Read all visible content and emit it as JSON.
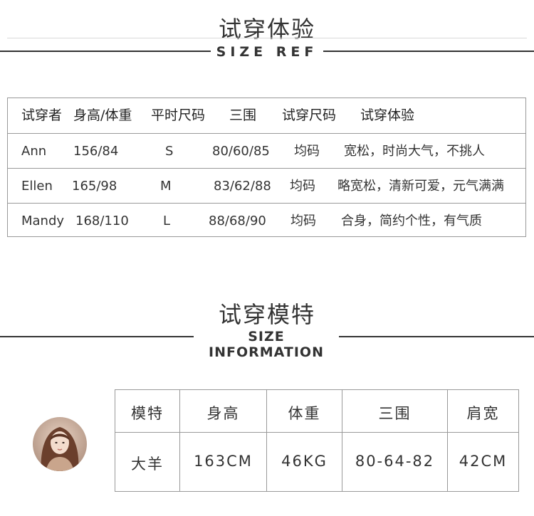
{
  "section1": {
    "title": "试穿体验",
    "subtitle": "SIZE REF"
  },
  "ref_table": {
    "headers": [
      "试穿者",
      "身高/体重",
      "平时尺码",
      "三围",
      "试穿尺码",
      "试穿体验"
    ],
    "rows": [
      [
        "Ann",
        "156/84",
        "S",
        "80/60/85",
        "均码",
        "宽松，时尚大气，不挑人"
      ],
      [
        "Ellen",
        "165/98",
        "M",
        "83/62/88",
        "均码",
        "略宽松，清新可爱，元气满满"
      ],
      [
        "Mandy",
        "168/110",
        "L",
        "88/68/90",
        "均码",
        "合身，简约个性，有气质"
      ]
    ]
  },
  "section2": {
    "title": "试穿模特",
    "subtitle": "SIZE INFORMATION"
  },
  "model_table": {
    "headers": [
      "模特",
      "身高",
      "体重",
      "三围",
      "肩宽"
    ],
    "row": [
      "大羊",
      "163CM",
      "46KG",
      "80-64-82",
      "42CM"
    ]
  },
  "avatar": {
    "icon": "model-portrait"
  }
}
